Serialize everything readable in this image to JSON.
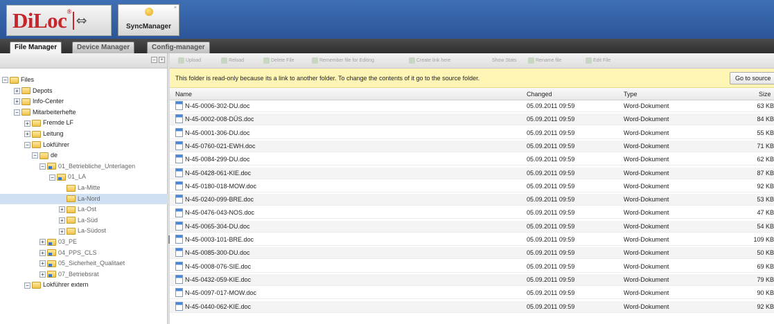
{
  "header": {
    "logo_text": "DiLoc",
    "logo_reg": "®",
    "logo_arrows": "⇔",
    "sync_tab_label": "SyncManager",
    "sync_close": "×"
  },
  "tabs": [
    "File Manager",
    "Device Manager",
    "Config-manager"
  ],
  "active_tab": "File Manager",
  "tree": [
    {
      "label": "Files",
      "toggle": "−",
      "level": 0,
      "link": false
    },
    {
      "label": "Depots",
      "toggle": "+",
      "level": 1,
      "link": false
    },
    {
      "label": "Info-Center",
      "toggle": "+",
      "level": 1,
      "link": false
    },
    {
      "label": "Mitarbeiterhefte",
      "toggle": "−",
      "level": 1,
      "link": false
    },
    {
      "label": "Fremde LF",
      "toggle": "+",
      "level": 2,
      "link": false
    },
    {
      "label": "Leitung",
      "toggle": "+",
      "level": 2,
      "link": false
    },
    {
      "label": "Lokführer",
      "toggle": "−",
      "level": 2,
      "link": false
    },
    {
      "label": "de",
      "toggle": "−",
      "level": 3,
      "link": false
    },
    {
      "label": "01_Betriebliche_Unterlagen",
      "toggle": "−",
      "level": 4,
      "link": true
    },
    {
      "label": "01_LA",
      "toggle": "−",
      "level": 5,
      "link": true
    },
    {
      "label": "La-Mitte",
      "toggle": "",
      "level": 6,
      "link": false
    },
    {
      "label": "La-Nord",
      "toggle": "",
      "level": 6,
      "link": false,
      "selected": true
    },
    {
      "label": "La-Ost",
      "toggle": "+",
      "level": 6,
      "link": false
    },
    {
      "label": "La-Süd",
      "toggle": "+",
      "level": 6,
      "link": false
    },
    {
      "label": "La-Südost",
      "toggle": "+",
      "level": 6,
      "link": false
    },
    {
      "label": "03_PE",
      "toggle": "+",
      "level": 4,
      "link": true
    },
    {
      "label": "04_PPS_CLS",
      "toggle": "+",
      "level": 4,
      "link": true
    },
    {
      "label": "05_Sicherheit_Qualitaet",
      "toggle": "+",
      "level": 4,
      "link": true
    },
    {
      "label": "07_Betriebsrat",
      "toggle": "+",
      "level": 4,
      "link": true
    },
    {
      "label": "Lokführer extern",
      "toggle": "−",
      "level": 2,
      "link": false
    }
  ],
  "toolbar": [
    "Upload",
    "Reload",
    "Delete File",
    "Remember file for Editing",
    "Create link here",
    "Show Stats",
    "Rename file",
    "Edit File"
  ],
  "notice": {
    "text": "This folder is read-only because its a link to another folder. To change the contents of it go to the source folder.",
    "button": "Go to source"
  },
  "columns": {
    "name": "Name",
    "changed": "Changed",
    "type": "Type",
    "size": "Size"
  },
  "files": [
    {
      "name": "N-45-0006-302-DU.doc",
      "changed": "05.09.2011 09:59",
      "type": "Word-Dokument",
      "size": "63 KB"
    },
    {
      "name": "N-45-0002-008-DÜS.doc",
      "changed": "05.09.2011 09:59",
      "type": "Word-Dokument",
      "size": "84 KB"
    },
    {
      "name": "N-45-0001-306-DU.doc",
      "changed": "05.09.2011 09:59",
      "type": "Word-Dokument",
      "size": "55 KB"
    },
    {
      "name": "N-45-0760-021-EWH.doc",
      "changed": "05.09.2011 09:59",
      "type": "Word-Dokument",
      "size": "71 KB"
    },
    {
      "name": "N-45-0084-299-DU.doc",
      "changed": "05.09.2011 09:59",
      "type": "Word-Dokument",
      "size": "62 KB"
    },
    {
      "name": "N-45-0428-061-KIE.doc",
      "changed": "05.09.2011 09:59",
      "type": "Word-Dokument",
      "size": "87 KB"
    },
    {
      "name": "N-45-0180-018-MOW.doc",
      "changed": "05.09.2011 09:59",
      "type": "Word-Dokument",
      "size": "92 KB"
    },
    {
      "name": "N-45-0240-099-BRE.doc",
      "changed": "05.09.2011 09:59",
      "type": "Word-Dokument",
      "size": "53 KB"
    },
    {
      "name": "N-45-0476-043-NOS.doc",
      "changed": "05.09.2011 09:59",
      "type": "Word-Dokument",
      "size": "47 KB"
    },
    {
      "name": "N-45-0065-304-DU.doc",
      "changed": "05.09.2011 09:59",
      "type": "Word-Dokument",
      "size": "54 KB"
    },
    {
      "name": "N-45-0003-101-BRE.doc",
      "changed": "05.09.2011 09:59",
      "type": "Word-Dokument",
      "size": "109 KB"
    },
    {
      "name": "N-45-0085-300-DU.doc",
      "changed": "05.09.2011 09:59",
      "type": "Word-Dokument",
      "size": "50 KB"
    },
    {
      "name": "N-45-0008-076-SIE.doc",
      "changed": "05.09.2011 09:59",
      "type": "Word-Dokument",
      "size": "69 KB"
    },
    {
      "name": "N-45-0432-059-KIE.doc",
      "changed": "05.09.2011 09:59",
      "type": "Word-Dokument",
      "size": "79 KB"
    },
    {
      "name": "N-45-0097-017-MOW.doc",
      "changed": "05.09.2011 09:59",
      "type": "Word-Dokument",
      "size": "90 KB"
    },
    {
      "name": "N-45-0440-062-KIE.doc",
      "changed": "05.09.2011 09:59",
      "type": "Word-Dokument",
      "size": "92 KB"
    }
  ],
  "colors": {
    "header_blue": "#3f6fb4",
    "logo_red": "#c5252b",
    "notice_yellow": "#fff6b5",
    "selected_row": "#cfe0f3"
  }
}
